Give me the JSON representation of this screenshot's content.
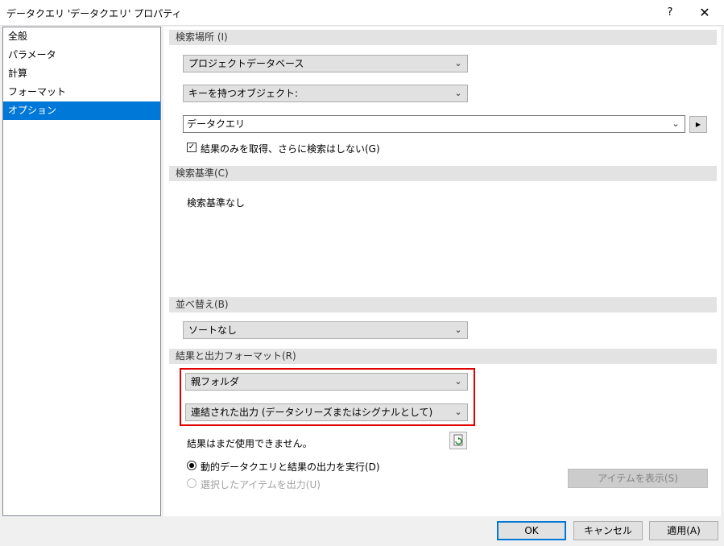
{
  "window": {
    "title": "データクエリ 'データクエリ' プロパティ",
    "help_glyph": "?",
    "close_glyph": "✕"
  },
  "nav": {
    "items": [
      {
        "label": "全般",
        "selected": false
      },
      {
        "label": "パラメータ",
        "selected": false
      },
      {
        "label": "計算",
        "selected": false
      },
      {
        "label": "フォーマット",
        "selected": false
      },
      {
        "label": "オプション",
        "selected": true
      }
    ]
  },
  "search_location": {
    "header": "検索場所 (I)",
    "database_dropdown": "プロジェクトデータベース",
    "object_dropdown": "キーを持つオブジェクト:",
    "object_combo": "データクエリ",
    "results_only_checkbox": {
      "label": "結果のみを取得、さらに検索はしない(G)",
      "checked": true
    }
  },
  "search_criteria": {
    "header": "検索基準(C)",
    "text": "検索基準なし"
  },
  "sort": {
    "header": "並べ替え(B)",
    "dropdown": "ソートなし"
  },
  "result_output": {
    "header": "結果と出力フォーマット(R)",
    "folder_dropdown": "親フォルダ",
    "output_dropdown": "連結された出力 (データシリーズまたはシグナルとして)",
    "status_text": "結果はまだ使用できません。",
    "radio_dynamic": {
      "label": "動的データクエリと結果の出力を実行(D)",
      "selected": true
    },
    "radio_selected": {
      "label": "選択したアイテムを出力(U)",
      "selected": false,
      "enabled": false
    },
    "show_items_button": "アイテムを表示(S)"
  },
  "footer": {
    "ok": "OK",
    "cancel": "キャンセル",
    "apply": "適用(A)"
  },
  "colors": {
    "selection": "#0078d7",
    "highlight_border": "#e00000"
  },
  "icons": {
    "chevron": "chevron-down-icon",
    "arrow": "play-arrow-icon",
    "refresh": "refresh-icon"
  }
}
